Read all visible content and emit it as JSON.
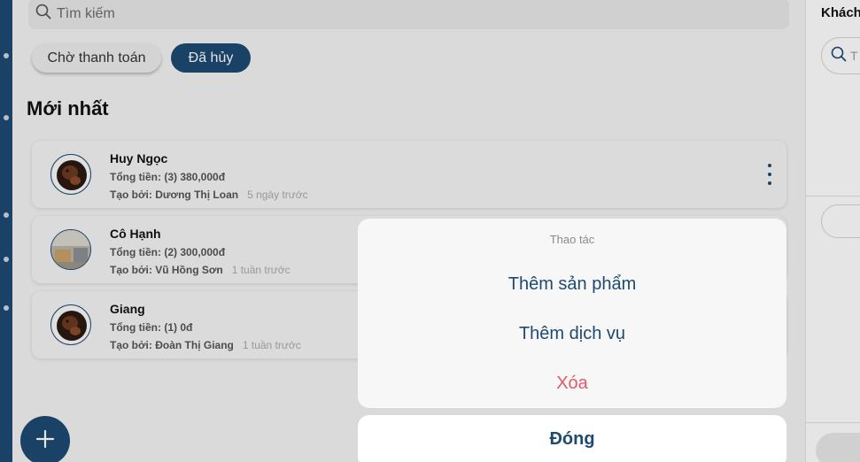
{
  "search": {
    "placeholder": "Tìm kiếm",
    "icon": "search-icon"
  },
  "filters": [
    {
      "label": "Chờ thanh toán",
      "active": false
    },
    {
      "label": "Đã hủy",
      "active": true
    }
  ],
  "section": {
    "title": "Mới nhất"
  },
  "orders": [
    {
      "name": "Huy Ngọc",
      "total": "Tổng tiền: (3) 380,000đ",
      "creator": "Tạo bởi: Dương Thị Loan",
      "time": "5 ngày trước",
      "avatar": "dog-avatar"
    },
    {
      "name": "Cô Hạnh",
      "total": "Tổng tiền: (2) 300,000đ",
      "creator": "Tạo bởi: Vũ Hồng Sơn",
      "time": "1 tuần trước",
      "avatar": "room-avatar"
    },
    {
      "name": "Giang",
      "total": "Tổng tiền: (1) 0đ",
      "creator": "Tạo bởi: Đoàn Thị Giang",
      "time": "1 tuần trước",
      "avatar": "dog-avatar"
    }
  ],
  "fab": {
    "icon": "plus-icon"
  },
  "right_panel": {
    "title": "Khách",
    "search_placeholder": "T"
  },
  "action_sheet": {
    "title": "Thao tác",
    "actions": [
      "Thêm sản phẩm",
      "Thêm dịch vụ",
      "Xóa"
    ],
    "close_label": "Đóng"
  },
  "colors": {
    "primary": "#1e4a72",
    "danger": "#e05a69",
    "background": "#f3f3f3"
  }
}
